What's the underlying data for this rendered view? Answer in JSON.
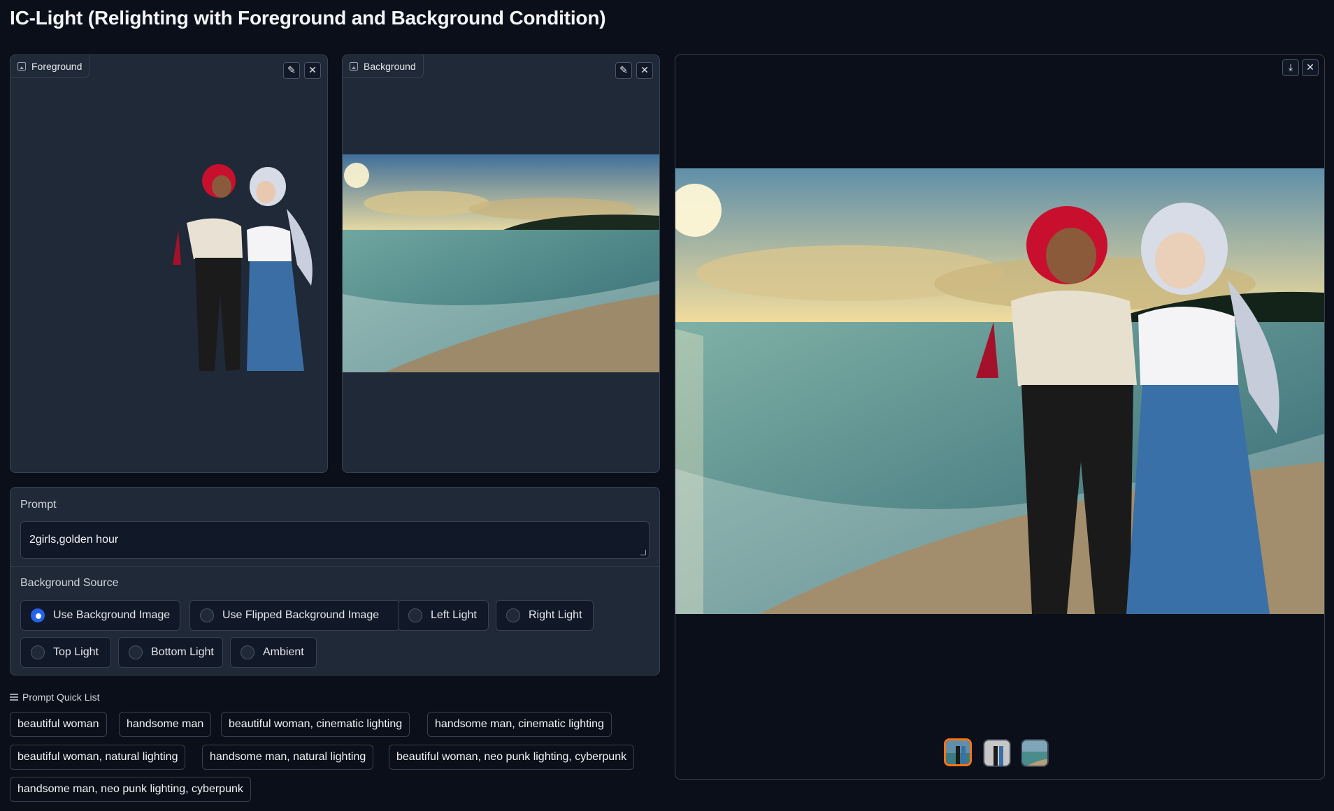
{
  "app": {
    "title": "IC-Light (Relighting with Foreground and Background Condition)"
  },
  "foreground": {
    "label": "Foreground"
  },
  "background": {
    "label": "Background"
  },
  "prompt": {
    "label": "Prompt",
    "value": "2girls,golden hour"
  },
  "background_source": {
    "label": "Background Source",
    "selected": "Use Background Image",
    "options": [
      "Use Background Image",
      "Use Flipped Background Image",
      "Left Light",
      "Right Light",
      "Top Light",
      "Bottom Light",
      "Ambient"
    ]
  },
  "quick_list": {
    "label": "Prompt Quick List",
    "items": [
      "beautiful woman",
      "handsome man",
      "beautiful woman, cinematic lighting",
      "handsome man, cinematic lighting",
      "beautiful woman, natural lighting",
      "handsome man, natural lighting",
      "beautiful woman, neo punk lighting, cyberpunk",
      "handsome man, neo punk lighting, cyberpunk"
    ]
  },
  "gallery": {
    "thumbnail_count": 3,
    "selected_index": 0
  },
  "colors": {
    "accent": "#2563eb",
    "selected_thumb": "#f97316",
    "bg": "#0b0f19",
    "panel": "#1f2937"
  },
  "icons": {
    "edit": "pencil-icon",
    "clear": "close-icon",
    "download": "download-icon",
    "image": "image-icon",
    "list": "list-icon"
  }
}
